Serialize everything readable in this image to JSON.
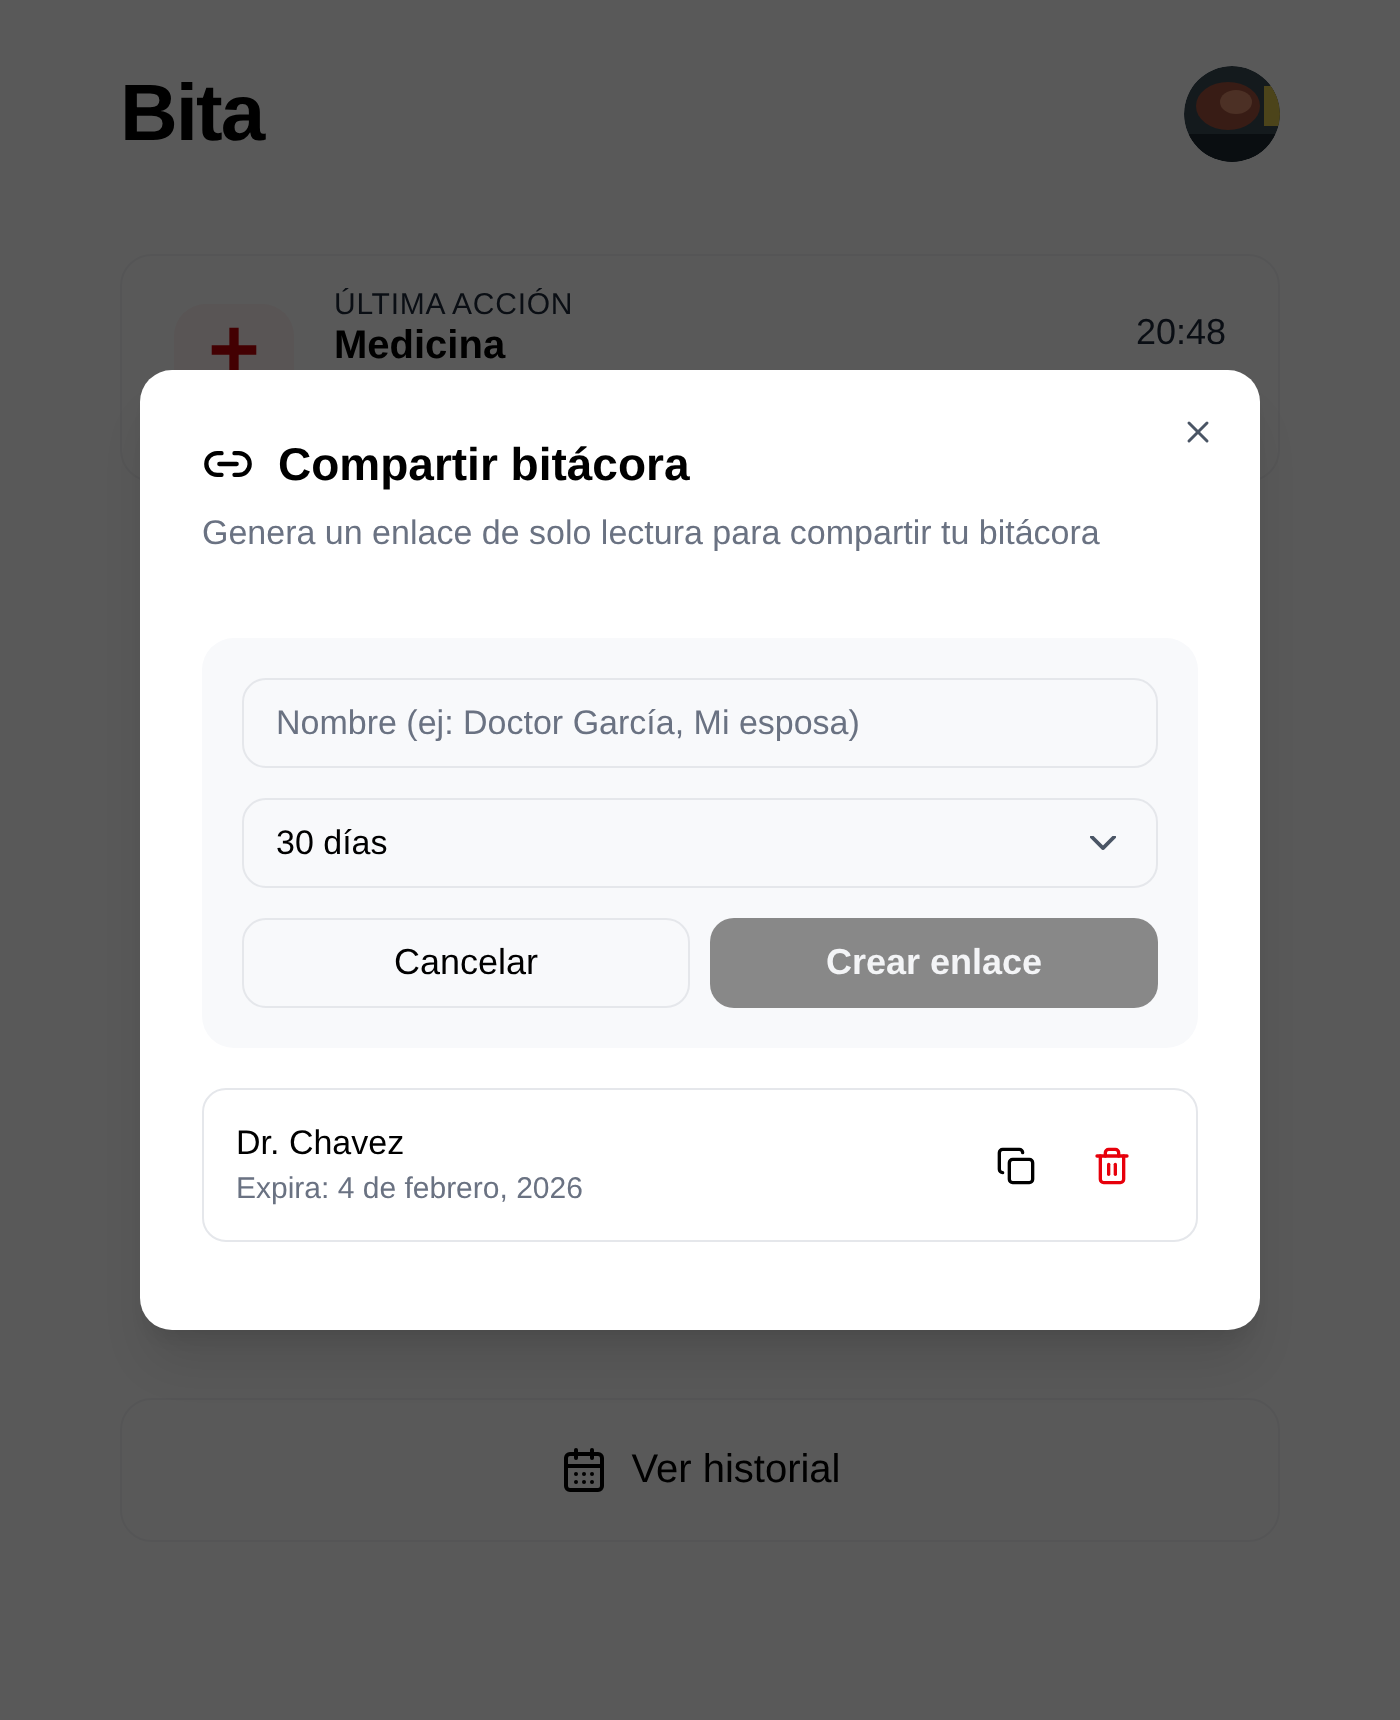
{
  "app": {
    "title": "Bita"
  },
  "last_action": {
    "label": "ÚLTIMA ACCIÓN",
    "name": "Medicina",
    "time": "20:48"
  },
  "history_button": {
    "label": "Ver historial"
  },
  "dialog": {
    "title": "Compartir bitácora",
    "subtitle": "Genera un enlace de solo lectura para compartir tu bitácora",
    "name_field": {
      "placeholder": "Nombre (ej: Doctor García, Mi esposa)"
    },
    "duration_select": {
      "value": "30 días"
    },
    "cancel_button": {
      "label": "Cancelar"
    },
    "create_button": {
      "label": "Crear enlace",
      "disabled": true
    },
    "links": [
      {
        "name": "Dr. Chavez",
        "expires": "Expira: 4 de febrero, 2026"
      }
    ]
  }
}
